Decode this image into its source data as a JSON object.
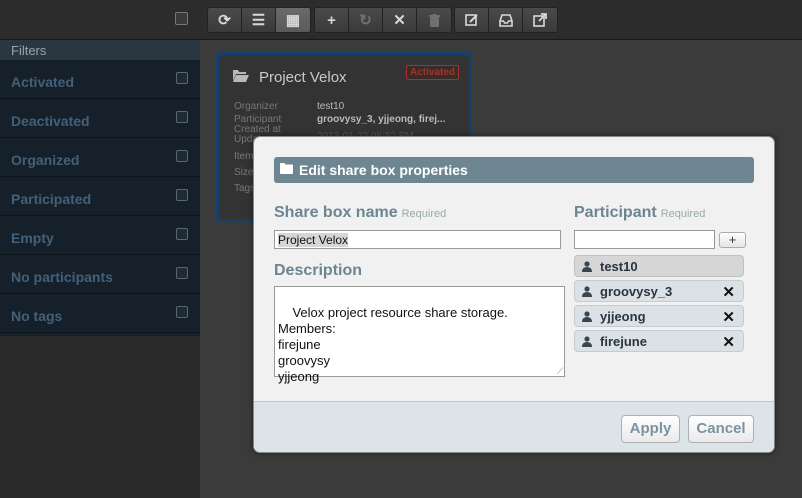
{
  "toolbar": {
    "groups": [
      {
        "buttons": [
          {
            "icon": "refresh-icon",
            "glyph": "⟳"
          },
          {
            "icon": "list-view-icon",
            "glyph": "☰"
          },
          {
            "icon": "grid-view-icon",
            "glyph": "▦"
          }
        ]
      },
      {
        "buttons": [
          {
            "icon": "add-icon",
            "glyph": "+"
          },
          {
            "icon": "sync-icon",
            "glyph": "↻"
          },
          {
            "icon": "close-icon",
            "glyph": "✕"
          },
          {
            "icon": "trash-icon",
            "glyph": "🗑"
          }
        ]
      },
      {
        "buttons": [
          {
            "icon": "edit-icon",
            "glyph": "✎"
          },
          {
            "icon": "inbox-icon",
            "glyph": "⎙"
          },
          {
            "icon": "share-icon",
            "glyph": "↗"
          }
        ]
      }
    ]
  },
  "sidebar": {
    "header": "Filters",
    "filters": [
      {
        "label": "Activated"
      },
      {
        "label": "Deactivated"
      },
      {
        "label": "Organized"
      },
      {
        "label": "Participated"
      },
      {
        "label": "Empty"
      },
      {
        "label": "No participants"
      },
      {
        "label": "No tags"
      }
    ]
  },
  "card": {
    "title": "Project Velox",
    "badge": "Activated",
    "organizer_label": "Organizer",
    "organizer_value": "test10",
    "participant_label": "Participant",
    "participant_value": "groovysy_3, yjjeong, firej...",
    "created_label": "Created at",
    "created_value": "2013-01-22 05:52 PM",
    "updated_label": "Updat",
    "items_label": "Item",
    "size_label": "Size",
    "tags_label": "Tags"
  },
  "modal": {
    "title": "Edit share box properties",
    "name_label": "Share box name",
    "name_required": "Required",
    "name_value": "Project Velox",
    "description_label": "Description",
    "description_value": "Velox project resource share storage.\nMembers:\nfirejune\ngroovysy\nyjjeong",
    "participant_label": "Participant",
    "participant_required": "Required",
    "participant_input_value": "",
    "add_label": "+",
    "participants": [
      {
        "name": "test10",
        "removable": false
      },
      {
        "name": "groovysy_3",
        "removable": true
      },
      {
        "name": "yjjeong",
        "removable": true
      },
      {
        "name": "firejune",
        "removable": true
      }
    ],
    "apply_label": "Apply",
    "cancel_label": "Cancel"
  },
  "colors": {
    "accent": "#6e8692",
    "card_border": "#14406e",
    "badge": "#a0352a"
  }
}
